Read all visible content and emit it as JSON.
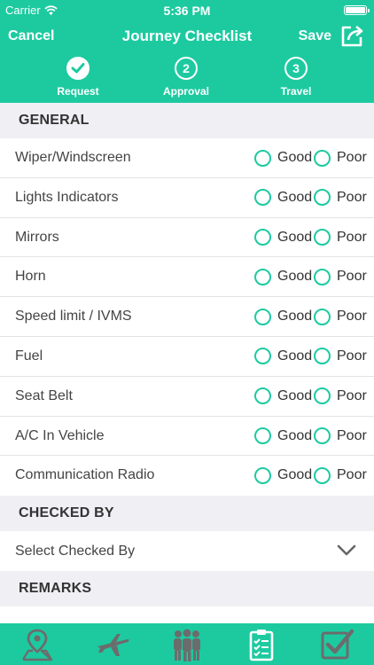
{
  "status_bar": {
    "carrier": "Carrier",
    "time": "5:36 PM"
  },
  "nav": {
    "cancel": "Cancel",
    "title": "Journey Checklist",
    "save": "Save"
  },
  "steps": [
    {
      "number": "",
      "label": "Request",
      "state": "done"
    },
    {
      "number": "2",
      "label": "Approval",
      "state": "pending"
    },
    {
      "number": "3",
      "label": "Travel",
      "state": "pending"
    }
  ],
  "sections": {
    "general": "GENERAL",
    "checked_by": "CHECKED BY",
    "remarks": "REMARKS"
  },
  "options": {
    "good": "Good",
    "poor": "Poor"
  },
  "checklist": [
    "Wiper/Windscreen",
    "Lights Indicators",
    "Mirrors",
    "Horn",
    "Speed limit / IVMS",
    "Fuel",
    "Seat Belt",
    "A/C In Vehicle",
    "Communication Radio"
  ],
  "checked_by": {
    "placeholder": "Select Checked By"
  },
  "remarks": {
    "value": ""
  },
  "tabs": [
    "location-pin-icon",
    "airplane-icon",
    "people-group-icon",
    "checklist-icon",
    "check-box-icon"
  ],
  "colors": {
    "accent": "#1dcaa0",
    "section_bg": "#efeff4"
  }
}
